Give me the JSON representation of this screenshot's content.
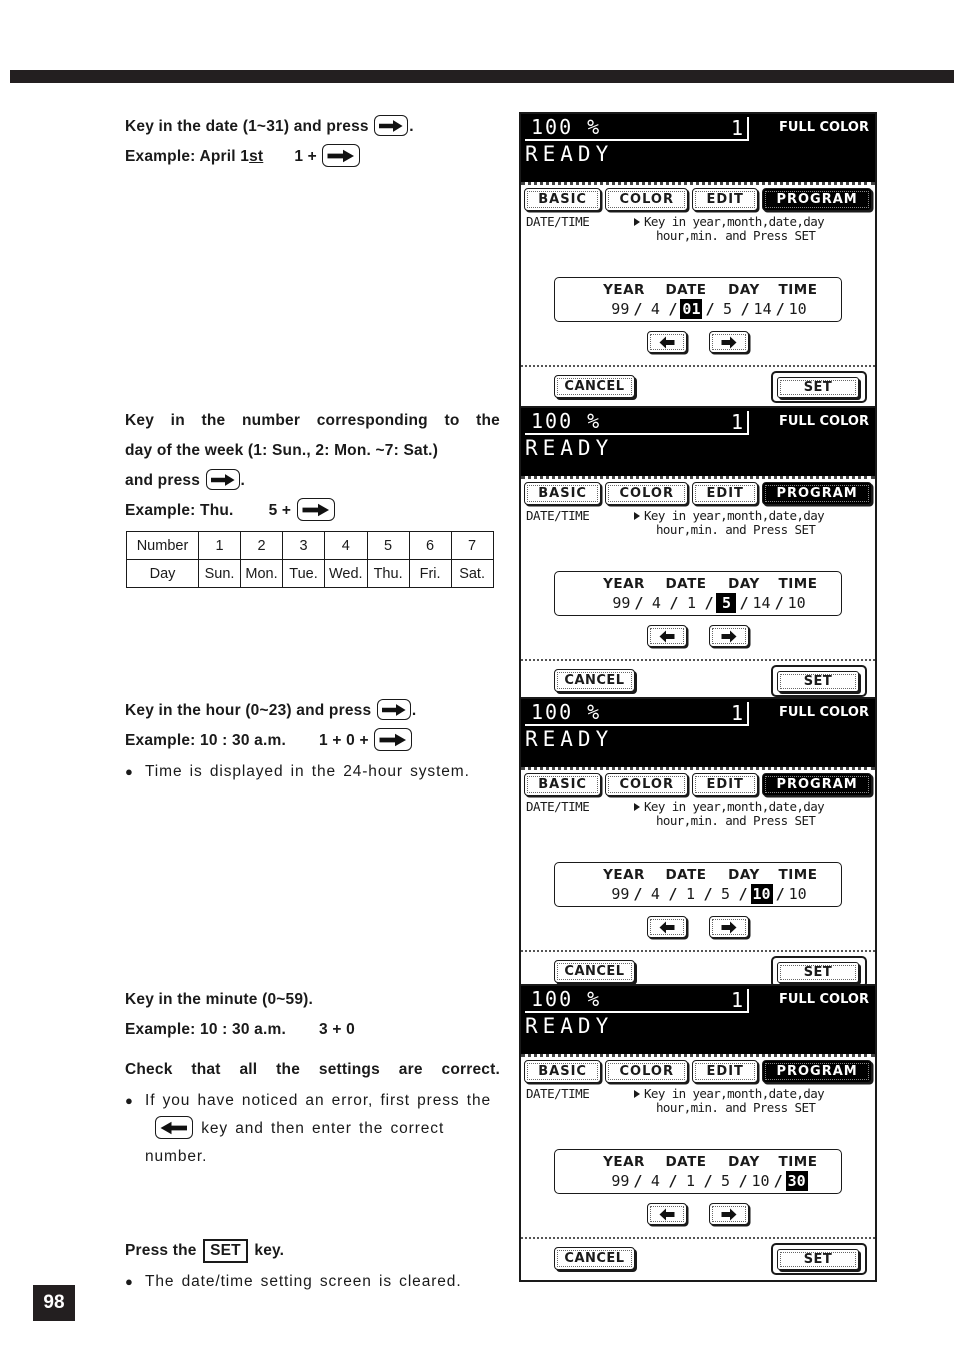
{
  "page": {
    "number": "98"
  },
  "sections": [
    {
      "id": "date",
      "heading_line1_a": "Key in the date (1~31) and press",
      "heading_line1_b": ".",
      "heading_line2_a": "Example: April 1",
      "heading_line2_sup": "st",
      "heading_line2_b": "1 +",
      "key_icon": "right-arrow-key-icon"
    },
    {
      "id": "day",
      "heading_line1": "Key in the number corresponding to the",
      "heading_line2": "day of the week (1: Sun., 2: Mon. ~7: Sat.)",
      "heading_line3_a": "and press",
      "heading_line3_b": ".",
      "heading_line4_a": "Example: Thu.",
      "heading_line4_b": "5 +",
      "key_icon": "right-arrow-key-icon"
    },
    {
      "id": "hour",
      "heading_line1_a": "Key in the hour (0~23) and press",
      "heading_line1_b": ".",
      "heading_line2_a": "Example: 10 : 30 a.m.",
      "heading_line2_b": "1 + 0 +",
      "bullet": "Time is displayed in the 24-hour system.",
      "key_icon": "right-arrow-key-icon"
    },
    {
      "id": "minute",
      "heading_line1": "Key in the minute (0~59).",
      "heading_line2_a": "Example: 10 : 30 a.m.",
      "heading_line2_b": "3 + 0",
      "check_heading": "Check that all the settings are correct.",
      "check_bullet_a": "If you have noticed an error, first press the",
      "check_bullet_b": "key and then enter the correct number.",
      "key_icon": "left-arrow-key-icon"
    },
    {
      "id": "press-set",
      "heading_a": "Press the",
      "heading_set": "SET",
      "heading_b": "key.",
      "bullet": "The date/time setting screen is cleared."
    }
  ],
  "day_table": {
    "row_labels": [
      "Number",
      "Day"
    ],
    "numbers": [
      "1",
      "2",
      "3",
      "4",
      "5",
      "6",
      "7"
    ],
    "days": [
      "Sun.",
      "Mon.",
      "Tue.",
      "Wed.",
      "Thu.",
      "Fri.",
      "Sat."
    ]
  },
  "lcd_common": {
    "ratio": "100 %",
    "copies": "1",
    "color_mode": "FULL COLOR",
    "status": "READY",
    "tabs": [
      {
        "label": "BASIC",
        "selected": false
      },
      {
        "label": "COLOR",
        "selected": false
      },
      {
        "label": "EDIT",
        "selected": false
      },
      {
        "label": "PROGRAM",
        "selected": true
      }
    ],
    "screen_label": "DATE/TIME",
    "message_line1": "Key in year,month,date,day",
    "message_line2": "hour,min. and Press SET",
    "field_headers": [
      "YEAR",
      "DATE",
      "DAY",
      "TIME"
    ],
    "separator": "/",
    "left_arrow_icon": "left-arrow-icon",
    "right_arrow_icon": "right-arrow-icon",
    "cancel_label": "CANCEL",
    "set_label": "SET"
  },
  "lcd_panels": [
    {
      "id": "panel-date",
      "values": [
        "99",
        "4",
        "01",
        "5",
        "14",
        "10"
      ],
      "highlight_index": 2
    },
    {
      "id": "panel-day",
      "values": [
        "99",
        "4",
        "1",
        "5",
        "14",
        "10"
      ],
      "highlight_index": 3
    },
    {
      "id": "panel-hour",
      "values": [
        "99",
        "4",
        "1",
        "5",
        "10",
        "10"
      ],
      "highlight_index": 4
    },
    {
      "id": "panel-minute",
      "values": [
        "99",
        "4",
        "1",
        "5",
        "10",
        "30"
      ],
      "highlight_index": 5
    }
  ],
  "colors": {
    "ink": "#231f20",
    "lcd_header_bg": "#000000",
    "lcd_bg": "#ffffff"
  }
}
